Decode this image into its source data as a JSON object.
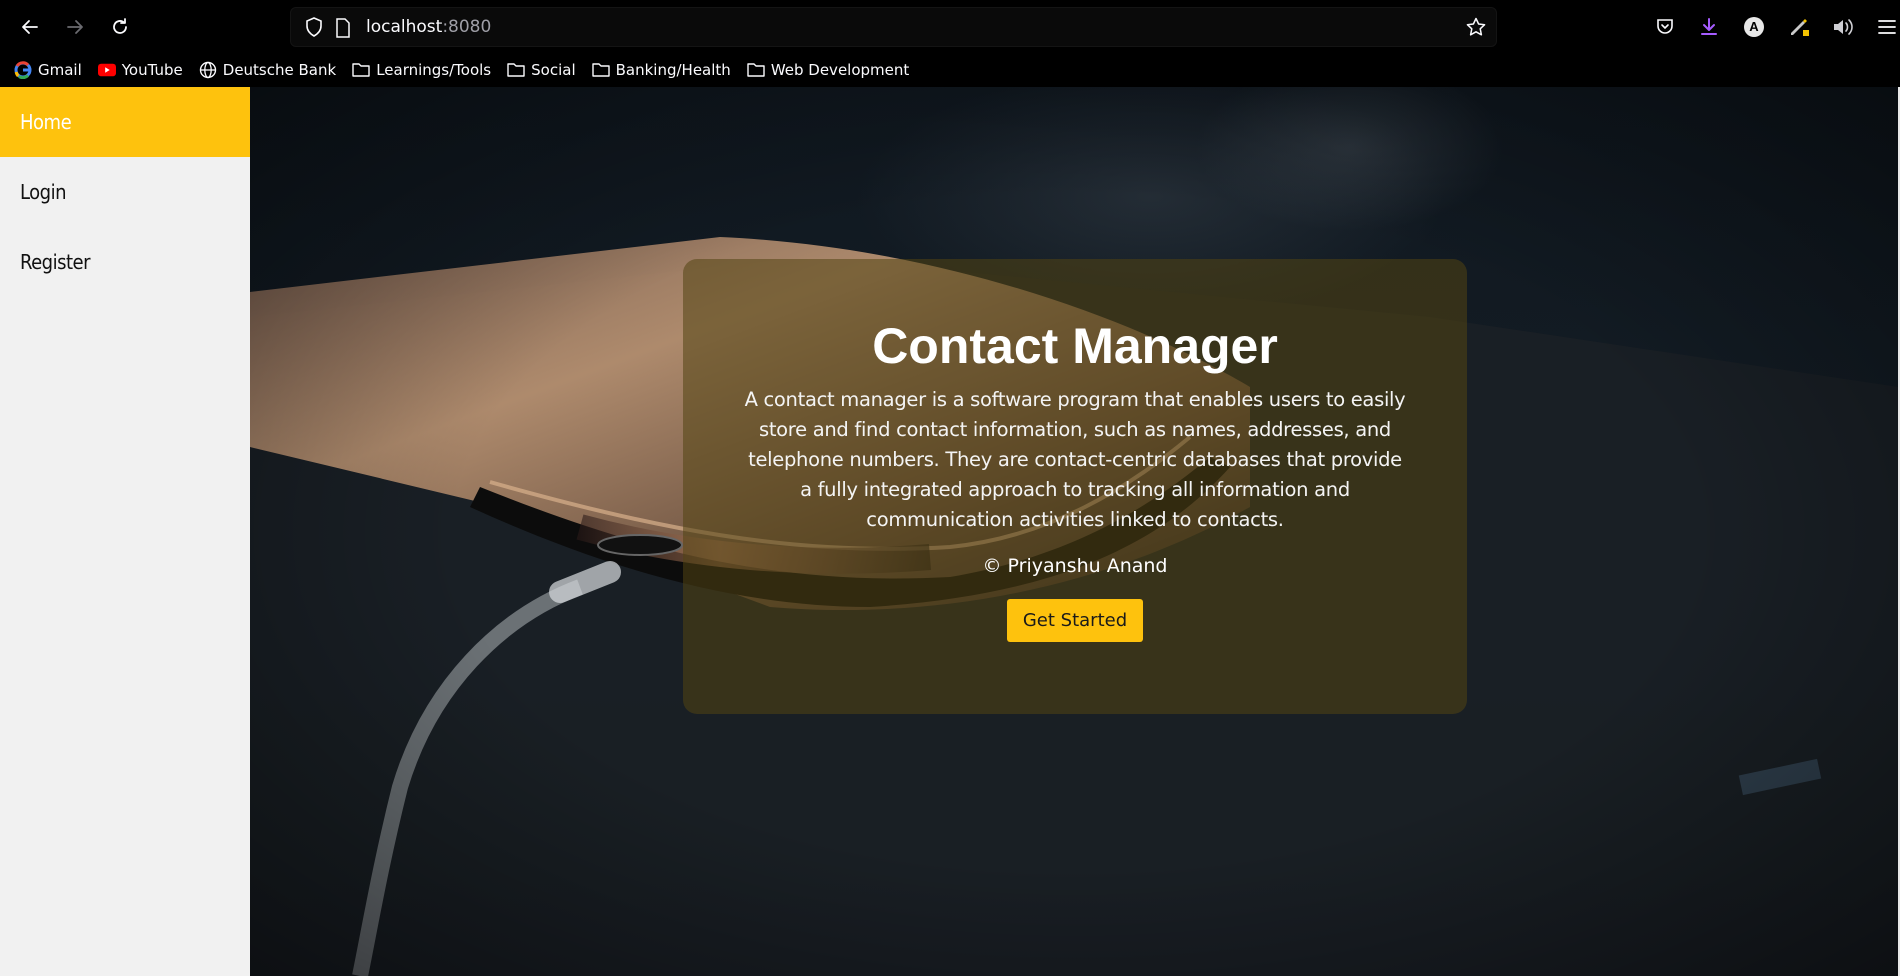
{
  "browser": {
    "url_host": "localhost",
    "url_port": ":8080",
    "bookmarks": [
      {
        "label": "Gmail",
        "icon": "google-icon"
      },
      {
        "label": "YouTube",
        "icon": "youtube-icon"
      },
      {
        "label": "Deutsche Bank",
        "icon": "globe-icon"
      },
      {
        "label": "Learnings/Tools",
        "icon": "folder-icon"
      },
      {
        "label": "Social",
        "icon": "folder-icon"
      },
      {
        "label": "Banking/Health",
        "icon": "folder-icon"
      },
      {
        "label": "Web Development",
        "icon": "folder-icon"
      }
    ],
    "profile_initial": "A"
  },
  "sidebar": {
    "items": [
      {
        "label": "Home",
        "active": true
      },
      {
        "label": "Login",
        "active": false
      },
      {
        "label": "Register",
        "active": false
      }
    ]
  },
  "hero": {
    "title": "Contact Manager",
    "description": "A contact manager is a software program that enables users to easily store and find contact information, such as names, addresses, and telephone numbers. They are contact-centric databases that provide a fully integrated approach to tracking all information and communication activities linked to contacts.",
    "copyright": "© Priyanshu Anand",
    "cta_label": "Get Started"
  },
  "colors": {
    "accent": "#fec20d",
    "sidebar_bg": "#f1f1f1"
  }
}
